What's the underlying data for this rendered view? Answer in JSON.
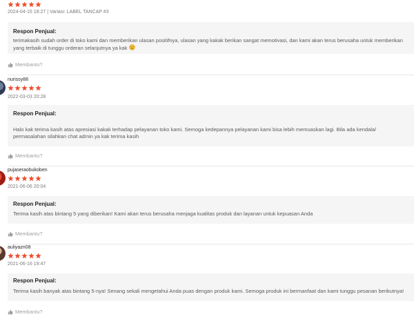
{
  "reviews": [
    {
      "username": "",
      "rating": 5,
      "meta": "2024-04-15 18:27 | Variasi: LABEL TANCAP #3",
      "reply_title": "Respon Penjual:",
      "reply_text": "terimakasih sudah order di toko kami dan memberikan ulasan positifnya, ulasan yang kakak berikan sangat memotivasi, dan kami akan terus berusaha untuk memberikan yang terbaik di tunggu orderan selanjutnya ya kak",
      "helpful_label": "Membantu?"
    },
    {
      "username": "nurissy88",
      "rating": 5,
      "meta": "2022-03-03 20:28",
      "reply_title": "Respon Penjual:",
      "reply_text": "Halo kak terima kasih atas apresiasi kakak terhadap pelayanan toko kami. Semoga kedepannya pelayanan kami bisa lebih memuaskan lagi. Bila ada kendala/ permasalahan silahkan chat admin ya kak terima kasih",
      "helpful_label": "Membantu?"
    },
    {
      "username": "pujaseraobukoben",
      "rating": 5,
      "meta": "2021-06-06 20:04",
      "reply_title": "Respon Penjual:",
      "reply_text": "Terima kasih atas bintang 5 yang diberikan! Kami akan terus berusaha menjaga kualitas produk dan layanan untuk kepuasan Anda",
      "helpful_label": "Membantu?"
    },
    {
      "username": "auliyazn08",
      "rating": 5,
      "meta": "2021-06-16 19:47",
      "reply_title": "Respon Penjual:",
      "reply_text": "Terima kasih banyak atas bintang 5-nya! Senang sekali mengetahui Anda puas dengan produk kami. Semoga produk ini bermanfaat dan kami tunggu pesanan berikutnya!",
      "helpful_label": "Membantu?"
    }
  ],
  "colors": {
    "star": "#ee4d2d",
    "reply_bg": "#f5f5f5",
    "muted": "#9e9e9e"
  },
  "icons": {
    "star": "star-icon",
    "thumbs_up": "thumbs-up-icon",
    "emoji": "smile-emoji-icon"
  }
}
